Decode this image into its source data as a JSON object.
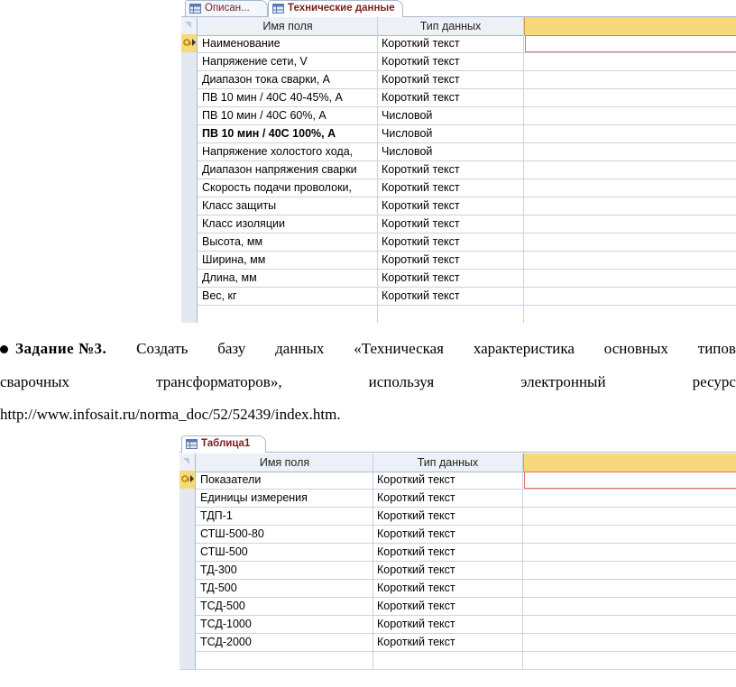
{
  "designer1": {
    "tabs": [
      {
        "label": "Описан...",
        "active": false
      },
      {
        "label": "Технические данные",
        "active": true
      }
    ],
    "headers": {
      "field_name": "Имя поля",
      "data_type": "Тип данных"
    },
    "rows": [
      {
        "name": "Наименование",
        "type": "Короткий текст",
        "key": true,
        "bold": false
      },
      {
        "name": "Напряжение сети, V",
        "type": "Короткий текст",
        "key": false,
        "bold": false
      },
      {
        "name": "Диапазон тока сварки, А",
        "type": "Короткий текст",
        "key": false,
        "bold": false
      },
      {
        "name": "ПВ 10 мин / 40С 40-45%, А",
        "type": "Короткий текст",
        "key": false,
        "bold": false
      },
      {
        "name": "ПВ 10 мин / 40С 60%, А",
        "type": "Числовой",
        "key": false,
        "bold": false
      },
      {
        "name": "ПВ 10 мин / 40С 100%, А",
        "type": "Числовой",
        "key": false,
        "bold": true
      },
      {
        "name": "Напряжение холостого хода,",
        "type": "Числовой",
        "key": false,
        "bold": false
      },
      {
        "name": "Диапазон напряжения сварки",
        "type": "Короткий текст",
        "key": false,
        "bold": false
      },
      {
        "name": "Скорость подачи проволоки,",
        "type": "Короткий текст",
        "key": false,
        "bold": false
      },
      {
        "name": "Класс защиты",
        "type": "Короткий текст",
        "key": false,
        "bold": false
      },
      {
        "name": "Класс изоляции",
        "type": "Короткий текст",
        "key": false,
        "bold": false
      },
      {
        "name": "Высота, мм",
        "type": "Короткий текст",
        "key": false,
        "bold": false
      },
      {
        "name": "Ширина, мм",
        "type": "Короткий текст",
        "key": false,
        "bold": false
      },
      {
        "name": "Длина, мм",
        "type": "Короткий текст",
        "key": false,
        "bold": false
      },
      {
        "name": "Вес, кг",
        "type": "Короткий текст",
        "key": false,
        "bold": false
      }
    ]
  },
  "task": {
    "bullet": "●",
    "label": "Задание №3.",
    "line1": [
      "Создать",
      "базу",
      "данных",
      "«Техническая",
      "характеристика",
      "основных",
      "типов"
    ],
    "line2": [
      "сварочных",
      "трансформаторов»,",
      "используя",
      "электронный",
      "ресурс"
    ],
    "line3": "http://www.infosait.ru/norma_doc/52/52439/index.htm."
  },
  "designer2": {
    "tabs": [
      {
        "label": "Таблица1",
        "active": true
      }
    ],
    "headers": {
      "field_name": "Имя поля",
      "data_type": "Тип данных"
    },
    "rows": [
      {
        "name": "Показатели",
        "type": "Короткий текст",
        "key": true
      },
      {
        "name": "Единицы измерения",
        "type": "Короткий текст",
        "key": false
      },
      {
        "name": "ТДП-1",
        "type": "Короткий текст",
        "key": false
      },
      {
        "name": "СТШ-500-80",
        "type": "Короткий текст",
        "key": false
      },
      {
        "name": "СТШ-500",
        "type": "Короткий текст",
        "key": false
      },
      {
        "name": "ТД-300",
        "type": "Короткий текст",
        "key": false
      },
      {
        "name": "ТД-500",
        "type": "Короткий текст",
        "key": false
      },
      {
        "name": "ТСД-500",
        "type": "Короткий текст",
        "key": false
      },
      {
        "name": "ТСД-1000",
        "type": "Короткий текст",
        "key": false
      },
      {
        "name": "ТСД-2000",
        "type": "Короткий текст",
        "key": false
      }
    ]
  },
  "colors": {
    "tab_text": "#7b1e1e",
    "grid_line": "#c7d3e3",
    "header_bg": "#edf1f7",
    "selector_active": "#f7d87a",
    "active_cell_border": "#e86d6d"
  }
}
